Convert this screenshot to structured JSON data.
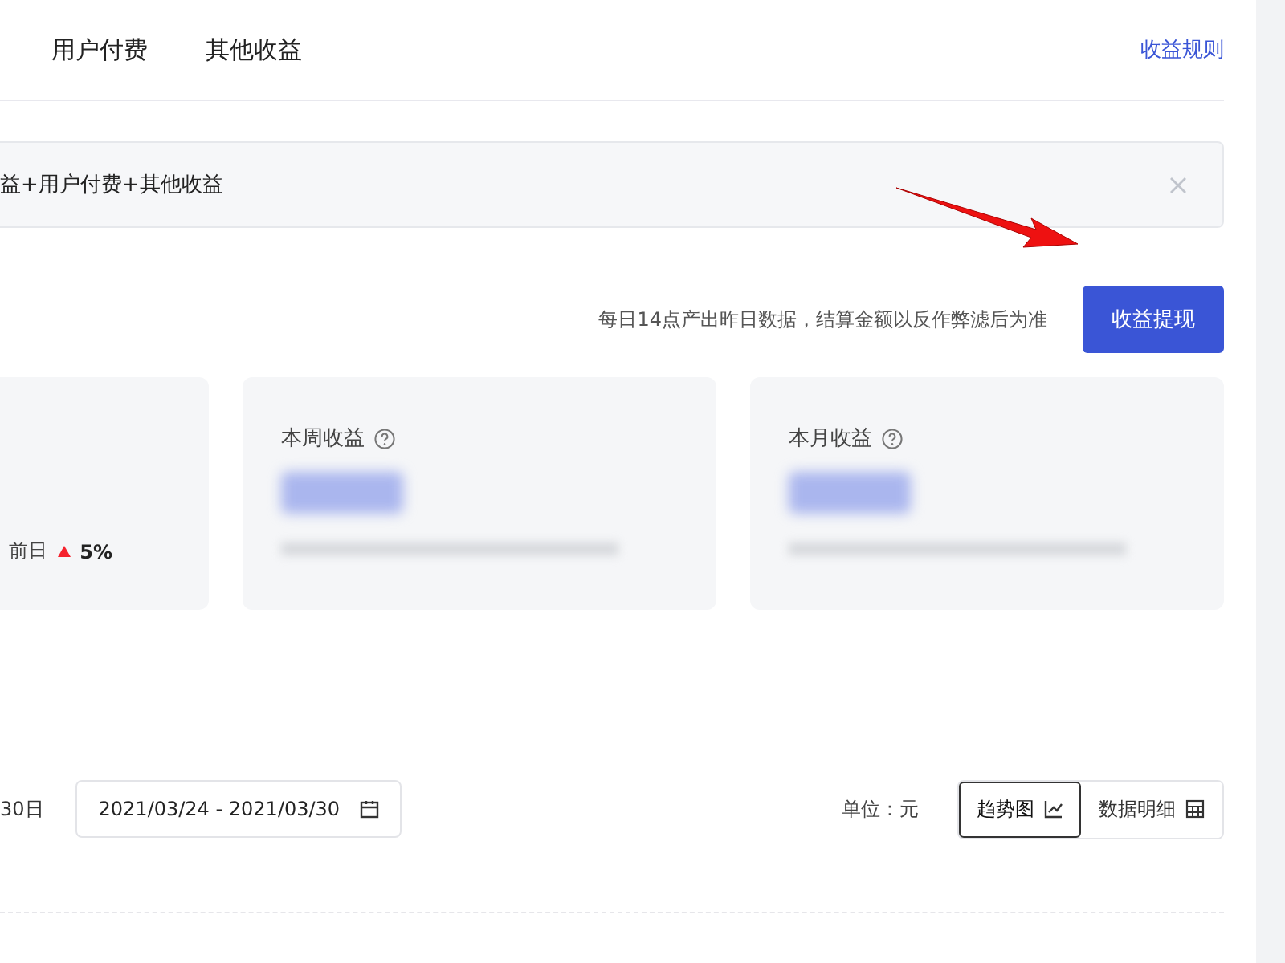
{
  "tabs": [
    {
      "label": "用户付费",
      "selected": false
    },
    {
      "label": "其他收益",
      "selected": false
    }
  ],
  "rules_link": "收益规则",
  "notice": {
    "text": "益+用户付费+其他收益"
  },
  "hint": "每日14点产出昨日数据，结算金额以反作弊滤后为准",
  "withdraw_button": "收益提现",
  "cards": [
    {
      "kind": "change",
      "compare_label": "前日",
      "increase": true,
      "change": "5%"
    },
    {
      "kind": "blurred",
      "title": "本周收益"
    },
    {
      "kind": "blurred",
      "title": "本月收益"
    }
  ],
  "filters": {
    "range_label": "30日",
    "date_range": "2021/03/24 - 2021/03/30",
    "unit": "单位：元"
  },
  "views": [
    {
      "label": "趋势图",
      "kind": "chart",
      "selected": true
    },
    {
      "label": "数据明细",
      "kind": "table",
      "selected": false
    }
  ]
}
